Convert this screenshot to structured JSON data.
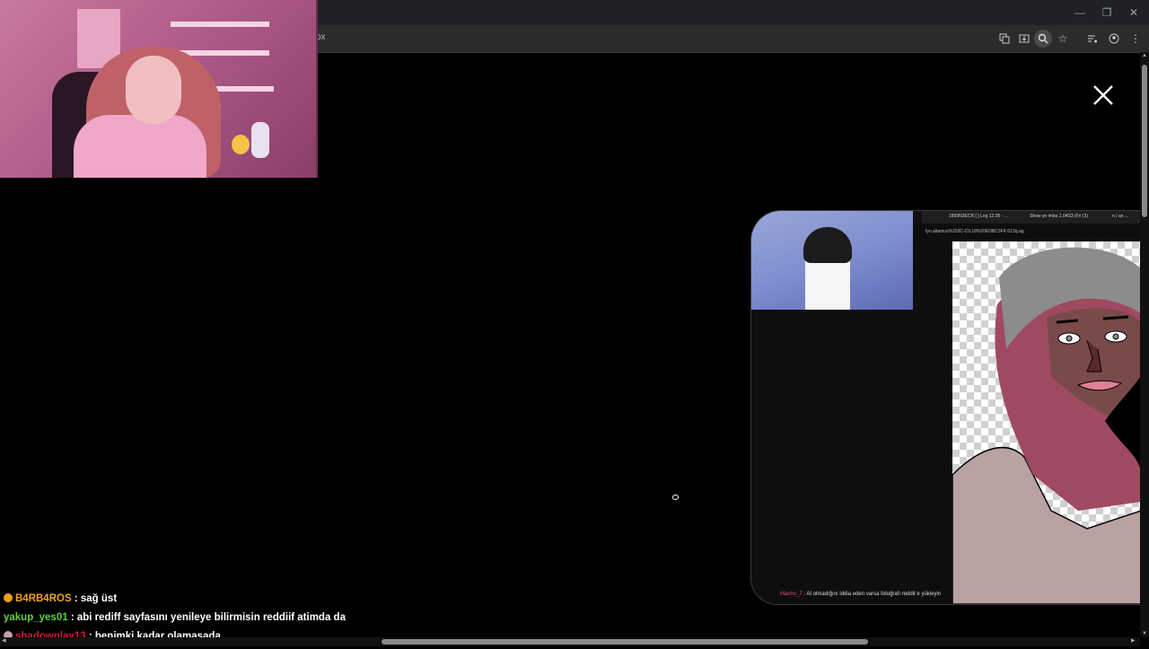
{
  "browser": {
    "url_fragment": "ox",
    "toolbar_icons": [
      "translate-icon",
      "install-app-icon",
      "zoom-icon",
      "bookmark-star-icon",
      "media-control-icon",
      "profile-icon",
      "menu-icon"
    ],
    "window_controls": [
      "minimize-icon",
      "restore-icon",
      "close-window-icon"
    ]
  },
  "overlay": {
    "close_icon": "close-icon"
  },
  "clip": {
    "tabs": [
      "1899N3ECR [ ] Log 12.05 - ...",
      "Show yn imba 1.04S3 (Fri (3)",
      "n / an ..."
    ],
    "url": "fyn.altamus%203C-C9.18%20EDBC3FK.013q.ag",
    "chat_user": "Machu_7",
    "chat_text": ": AI olmadığını iddia eden varsa fotoğrafı reddit e yükleyin"
  },
  "chat": {
    "messages": [
      {
        "user": "B4RB4ROS",
        "user_color": "#f0a020",
        "badge_color": "#f0a020",
        "text": "sağ üst"
      },
      {
        "user": "yakup_yes01",
        "user_color": "#5fd23a",
        "badge_color": "",
        "text": "abi rediff sayfasını yenileye bilirmisin reddiif atimda da"
      },
      {
        "user": "shadowplay13",
        "user_color": "#d01a3a",
        "badge_color": "#c7a0a8",
        "text": "benimki kadar olamasada"
      }
    ],
    "separator": ":"
  }
}
